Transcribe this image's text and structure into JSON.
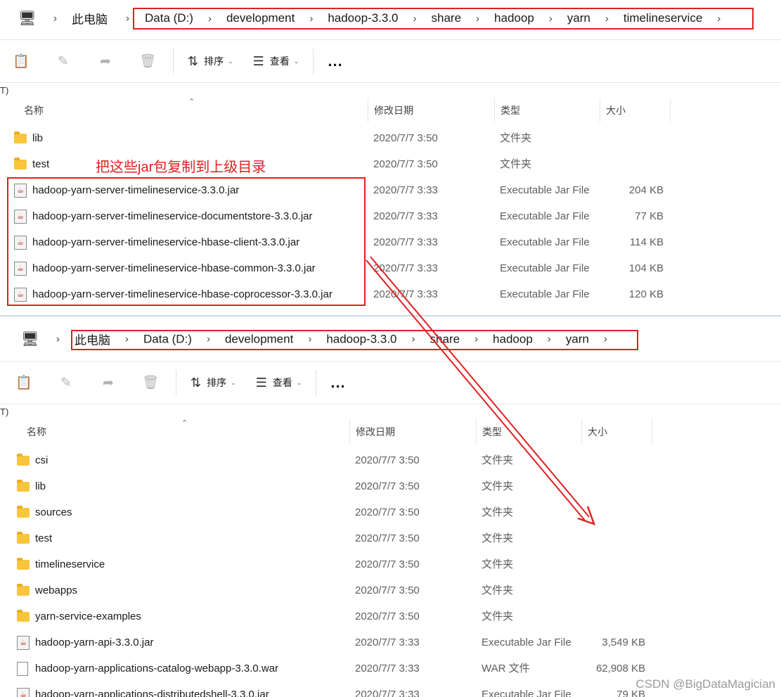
{
  "window1": {
    "breadcrumb": [
      "此电脑",
      "Data (D:)",
      "development",
      "hadoop-3.3.0",
      "share",
      "hadoop",
      "yarn",
      "timelineservice"
    ],
    "toolbar": {
      "sort_label": "排序",
      "view_label": "查看",
      "more_label": "..."
    },
    "truncated_label": "T)",
    "columns": {
      "name": "名称",
      "date": "修改日期",
      "type": "类型",
      "size": "大小"
    },
    "rows": [
      {
        "kind": "folder",
        "name": "lib",
        "date": "2020/7/7 3:50",
        "type": "文件夹",
        "size": ""
      },
      {
        "kind": "folder",
        "name": "test",
        "date": "2020/7/7 3:50",
        "type": "文件夹",
        "size": ""
      },
      {
        "kind": "jar",
        "name": "hadoop-yarn-server-timelineservice-3.3.0.jar",
        "date": "2020/7/7 3:33",
        "type": "Executable Jar File",
        "size": "204 KB"
      },
      {
        "kind": "jar",
        "name": "hadoop-yarn-server-timelineservice-documentstore-3.3.0.jar",
        "date": "2020/7/7 3:33",
        "type": "Executable Jar File",
        "size": "77 KB"
      },
      {
        "kind": "jar",
        "name": "hadoop-yarn-server-timelineservice-hbase-client-3.3.0.jar",
        "date": "2020/7/7 3:33",
        "type": "Executable Jar File",
        "size": "114 KB"
      },
      {
        "kind": "jar",
        "name": "hadoop-yarn-server-timelineservice-hbase-common-3.3.0.jar",
        "date": "2020/7/7 3:33",
        "type": "Executable Jar File",
        "size": "104 KB"
      },
      {
        "kind": "jar",
        "name": "hadoop-yarn-server-timelineservice-hbase-coprocessor-3.3.0.jar",
        "date": "2020/7/7 3:33",
        "type": "Executable Jar File",
        "size": "120 KB"
      }
    ]
  },
  "annotation": {
    "text": "把这些jar包复制到上级目录",
    "color": "#e02020"
  },
  "window2": {
    "breadcrumb": [
      "此电脑",
      "Data (D:)",
      "development",
      "hadoop-3.3.0",
      "share",
      "hadoop",
      "yarn"
    ],
    "toolbar": {
      "sort_label": "排序",
      "view_label": "查看",
      "more_label": "..."
    },
    "truncated_label": "T)",
    "columns": {
      "name": "名称",
      "date": "修改日期",
      "type": "类型",
      "size": "大小"
    },
    "rows": [
      {
        "kind": "folder",
        "name": "csi",
        "date": "2020/7/7 3:50",
        "type": "文件夹",
        "size": ""
      },
      {
        "kind": "folder",
        "name": "lib",
        "date": "2020/7/7 3:50",
        "type": "文件夹",
        "size": ""
      },
      {
        "kind": "folder",
        "name": "sources",
        "date": "2020/7/7 3:50",
        "type": "文件夹",
        "size": ""
      },
      {
        "kind": "folder",
        "name": "test",
        "date": "2020/7/7 3:50",
        "type": "文件夹",
        "size": ""
      },
      {
        "kind": "folder",
        "name": "timelineservice",
        "date": "2020/7/7 3:50",
        "type": "文件夹",
        "size": ""
      },
      {
        "kind": "folder",
        "name": "webapps",
        "date": "2020/7/7 3:50",
        "type": "文件夹",
        "size": ""
      },
      {
        "kind": "folder",
        "name": "yarn-service-examples",
        "date": "2020/7/7 3:50",
        "type": "文件夹",
        "size": ""
      },
      {
        "kind": "jar",
        "name": "hadoop-yarn-api-3.3.0.jar",
        "date": "2020/7/7 3:33",
        "type": "Executable Jar File",
        "size": "3,549 KB"
      },
      {
        "kind": "war",
        "name": "hadoop-yarn-applications-catalog-webapp-3.3.0.war",
        "date": "2020/7/7 3:33",
        "type": "WAR 文件",
        "size": "62,908 KB"
      },
      {
        "kind": "jar",
        "name": "hadoop-yarn-applications-distributedshell-3.3.0.jar",
        "date": "2020/7/7 3:33",
        "type": "Executable Jar File",
        "size": "79 KB"
      }
    ]
  },
  "watermark": "CSDN @BigDataMagician"
}
